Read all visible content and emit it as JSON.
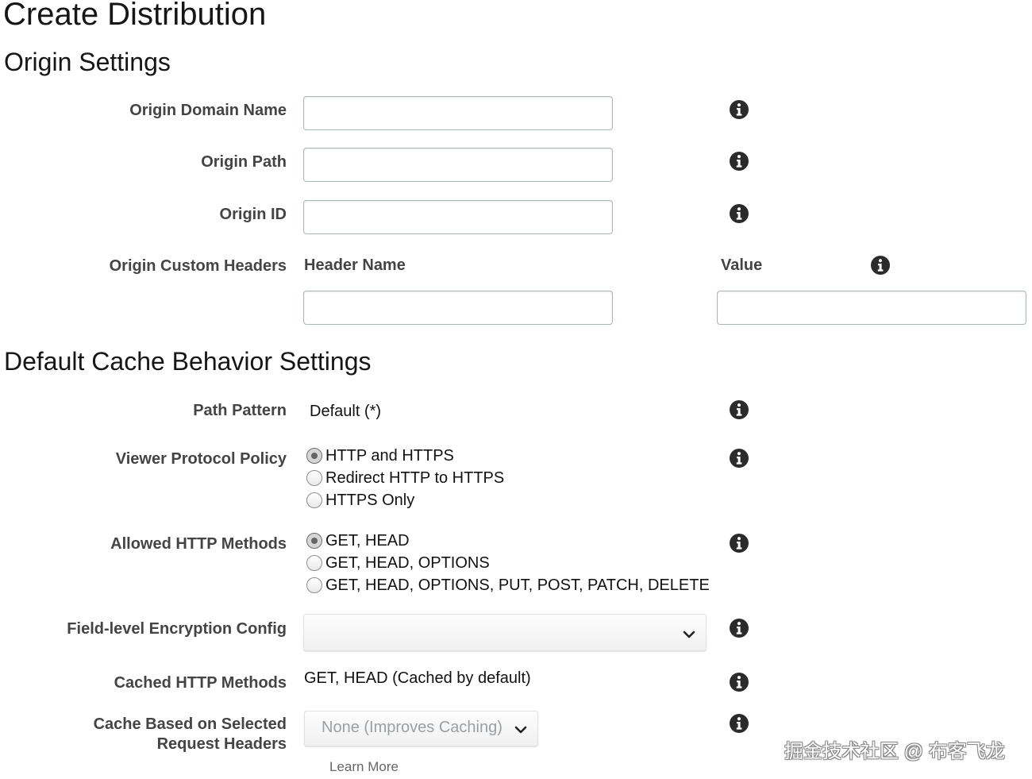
{
  "page": {
    "title": "Create Distribution"
  },
  "origin_settings": {
    "heading": "Origin Settings",
    "domain_name": {
      "label": "Origin Domain Name",
      "value": ""
    },
    "path": {
      "label": "Origin Path",
      "value": ""
    },
    "id": {
      "label": "Origin ID",
      "value": ""
    },
    "custom_headers": {
      "label": "Origin Custom Headers",
      "header_name_col": "Header Name",
      "value_col": "Value",
      "header_name_value": "",
      "value_value": ""
    }
  },
  "cache_behavior": {
    "heading": "Default Cache Behavior Settings",
    "path_pattern": {
      "label": "Path Pattern",
      "value": "Default (*)"
    },
    "viewer_protocol": {
      "label": "Viewer Protocol Policy",
      "options": [
        "HTTP and HTTPS",
        "Redirect HTTP to HTTPS",
        "HTTPS Only"
      ],
      "selected": "HTTP and HTTPS"
    },
    "allowed_methods": {
      "label": "Allowed HTTP Methods",
      "options": [
        "GET, HEAD",
        "GET, HEAD, OPTIONS",
        "GET, HEAD, OPTIONS, PUT, POST, PATCH, DELETE"
      ],
      "selected": "GET, HEAD"
    },
    "field_encryption": {
      "label": "Field-level Encryption Config",
      "value": ""
    },
    "cached_methods": {
      "label": "Cached HTTP Methods",
      "value": "GET, HEAD (Cached by default)"
    },
    "cache_headers": {
      "label_line1": "Cache Based on Selected",
      "label_line2": "Request Headers",
      "value": "None (Improves Caching)",
      "learn_more": "Learn More"
    }
  },
  "watermark": "掘金技术社区 @ 布客飞龙",
  "icons": {
    "info": "info-icon",
    "select": "chevron-down-icon"
  }
}
